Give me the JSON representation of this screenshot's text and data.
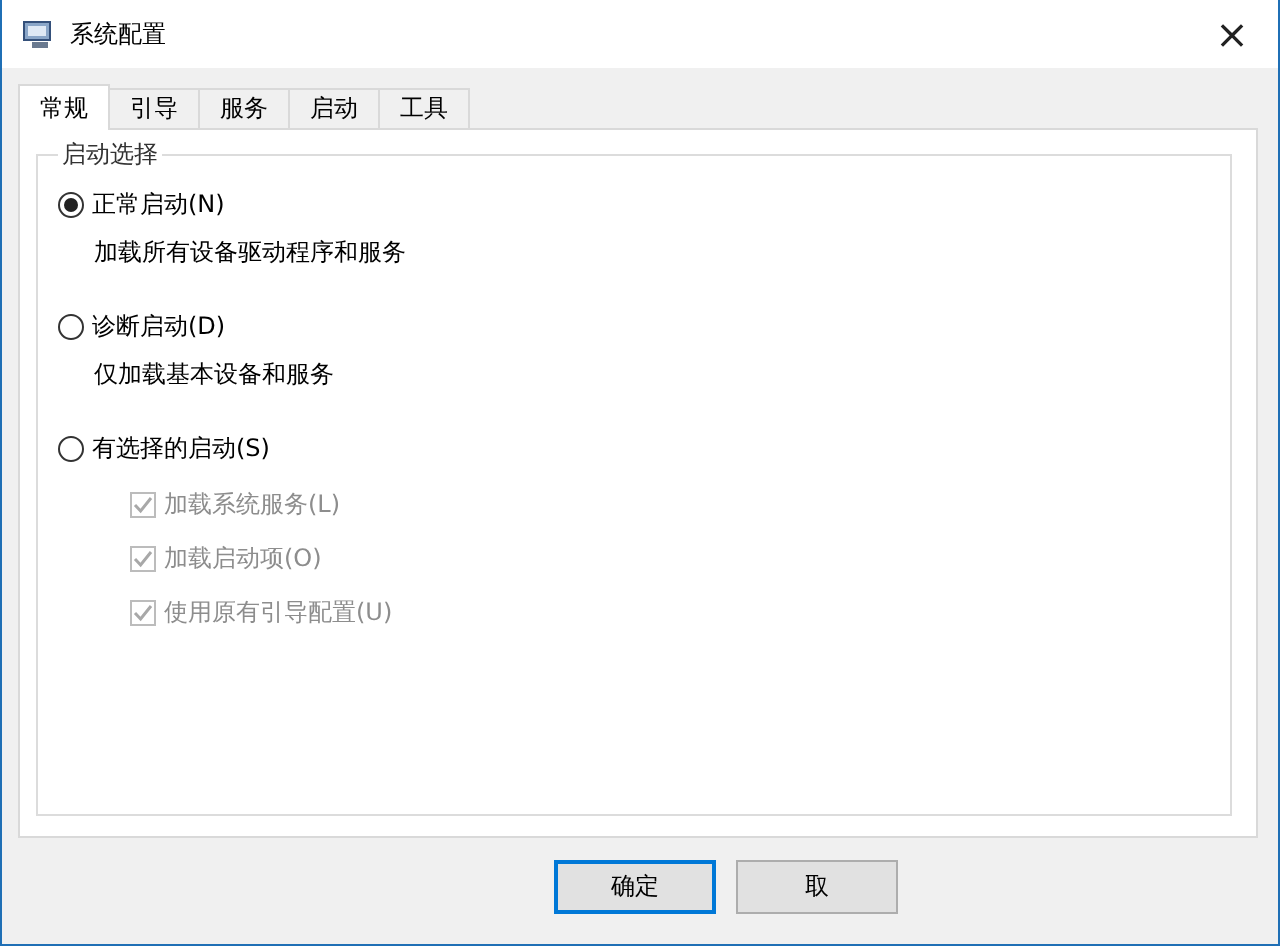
{
  "window": {
    "title": "系统配置",
    "close": "×"
  },
  "tabs": [
    {
      "label": "常规",
      "selected": true
    },
    {
      "label": "引导",
      "selected": false
    },
    {
      "label": "服务",
      "selected": false
    },
    {
      "label": "启动",
      "selected": false
    },
    {
      "label": "工具",
      "selected": false
    }
  ],
  "group": {
    "title": "启动选择",
    "options": [
      {
        "label": "正常启动(N)",
        "selected": true,
        "description": "加载所有设备驱动程序和服务"
      },
      {
        "label": "诊断启动(D)",
        "selected": false,
        "description": "仅加载基本设备和服务"
      },
      {
        "label": "有选择的启动(S)",
        "selected": false,
        "checkboxes": [
          {
            "label": "加载系统服务(L)",
            "checked": true,
            "disabled": true
          },
          {
            "label": "加载启动项(O)",
            "checked": true,
            "disabled": true
          },
          {
            "label": "使用原有引导配置(U)",
            "checked": true,
            "disabled": true
          }
        ]
      }
    ]
  },
  "buttons": [
    {
      "label": "确定",
      "default": true
    },
    {
      "label": "取",
      "default": false
    }
  ]
}
